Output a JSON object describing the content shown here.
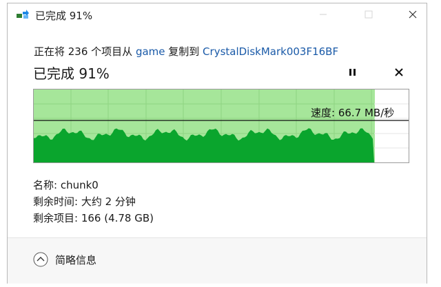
{
  "window": {
    "title": "已完成 91%",
    "icon": "file-copy-icon",
    "controls": [
      "minimize-icon",
      "maximize-icon",
      "close-icon"
    ]
  },
  "copy_info": {
    "prefix": "正在将 236 个项目从 ",
    "source": "game",
    "middle": " 复制到 ",
    "destination": "CrystalDiskMark003F16BF"
  },
  "progress": {
    "heading": "已完成 91%",
    "percent": 91
  },
  "speed": {
    "label": "速度: 66.7 MB/秒"
  },
  "details": {
    "name": "名称: chunk0",
    "time_remaining": "剩余时间: 大约 2 分钟",
    "items_remaining": "剩余项目: 166 (4.78 GB)"
  },
  "footer": {
    "toggle_label": "简略信息"
  },
  "colors": {
    "graph_fill": "#0aa52d",
    "graph_background": "#a6e69a",
    "graph_grid": "#8fd482",
    "link": "#1a5aa8"
  }
}
